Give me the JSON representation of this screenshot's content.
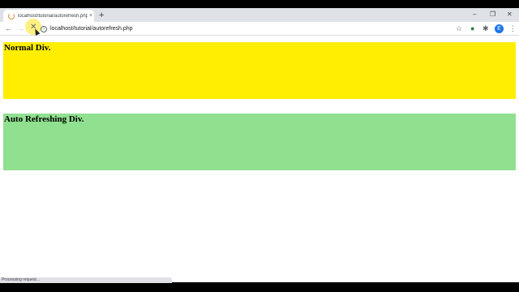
{
  "tab": {
    "title": "localhost/tutorial/autorefresh.php",
    "close": "×"
  },
  "new_tab": "+",
  "window": {
    "minimize": "–",
    "maximize": "❐",
    "close": "✕"
  },
  "toolbar": {
    "back": "←",
    "forward": "→",
    "stop": "✕",
    "info": "i",
    "url": "localhost/tutorial/autorefresh.php",
    "star": "☆",
    "extension_1": "●",
    "extension_2": "✱",
    "avatar": "E",
    "menu": "⋮"
  },
  "content": {
    "normal_div": {
      "heading": "Normal Div.",
      "color": "#ffee00"
    },
    "auto_div": {
      "heading": "Auto Refreshing Div.",
      "color": "#90e090"
    }
  },
  "status": "Processing request..."
}
